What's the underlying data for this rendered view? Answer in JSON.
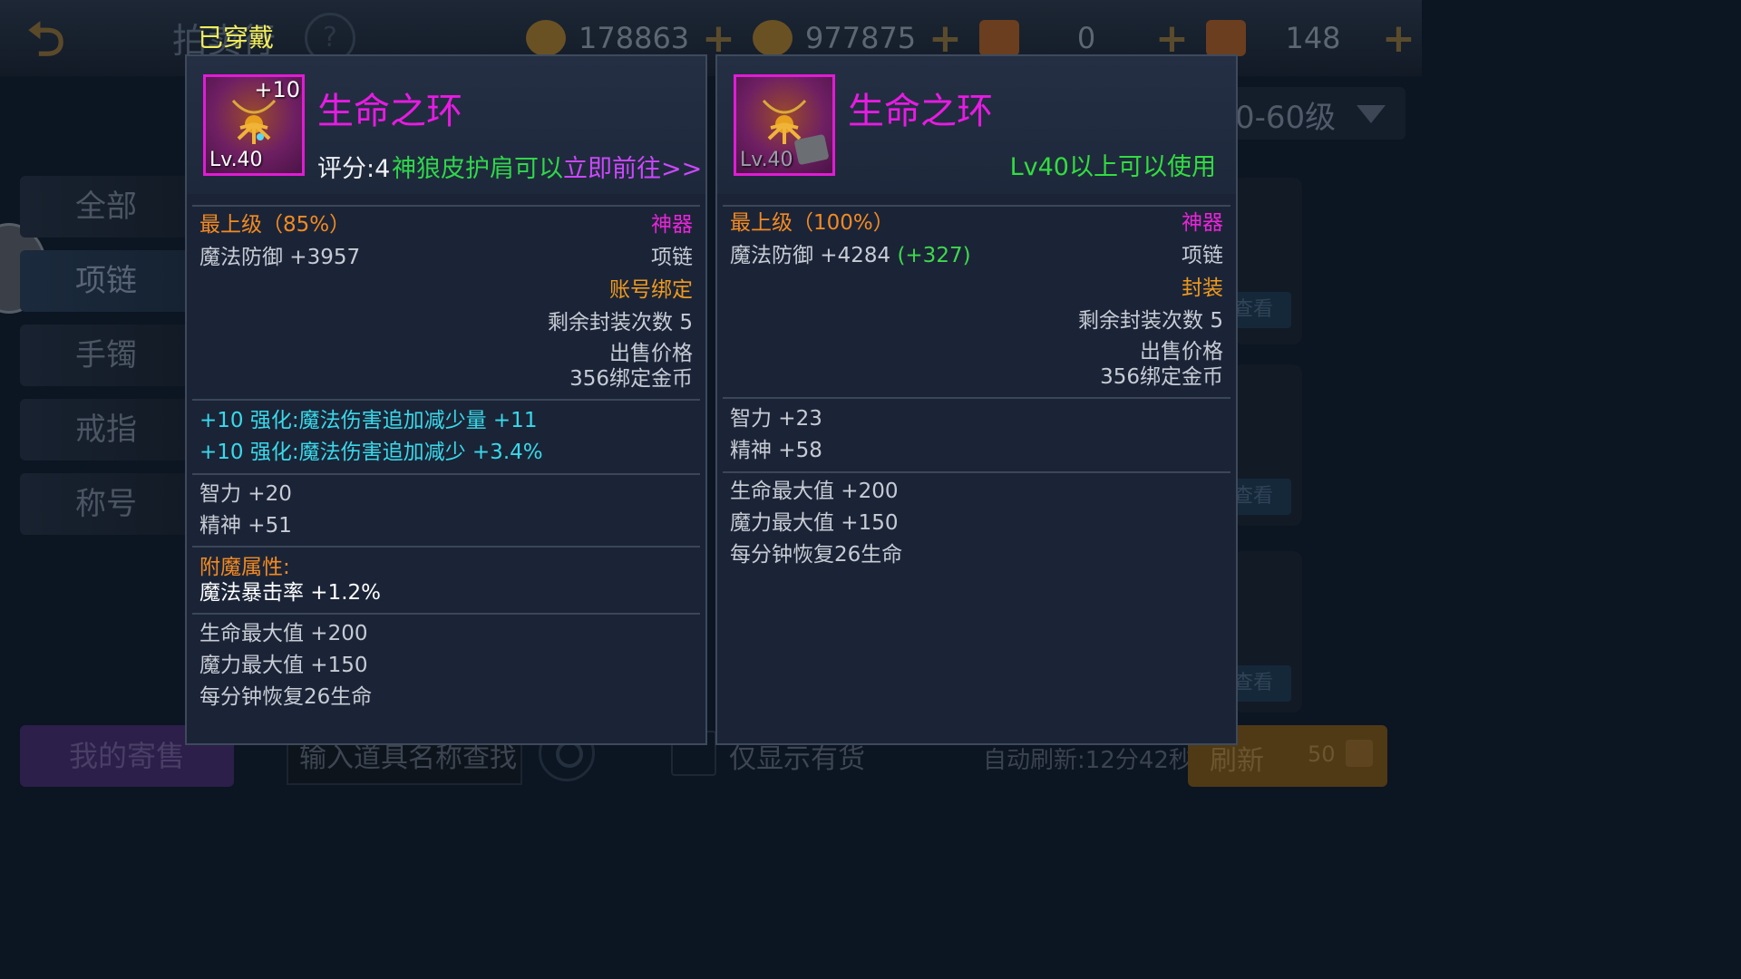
{
  "background": {
    "title": "拍卖行",
    "help_label": "?",
    "currencies": [
      {
        "icon": "coin-icon",
        "value": "178863",
        "plus": "+"
      },
      {
        "icon": "gold-coin-icon",
        "value": "977875",
        "plus": "+"
      },
      {
        "icon": "scroll-icon",
        "value": "0",
        "plus": "+"
      },
      {
        "icon": "scroll-icon",
        "value": "148",
        "plus": "+"
      }
    ],
    "level_filter": "0-60级",
    "categories": [
      "全部",
      "项链",
      "手镯",
      "戒指",
      "称号"
    ],
    "active_category": "项链",
    "detail_label": "查看详情",
    "my_sales": "我的寄售",
    "search_placeholder": "输入道具名称查找",
    "stock_only": "仅显示有货",
    "auto_refresh": "自动刷新:12分42秒",
    "refresh_label": "刷新",
    "refresh_cost": "50"
  },
  "equipped_tag": "已穿戴",
  "left_item": {
    "name": "生命之环",
    "enhance": "+10",
    "level": "Lv.40",
    "score": "评分:4",
    "promo_text": "神狼皮护肩",
    "promo_tail": "可以",
    "promo_link": "立即前往>>",
    "grade": "最上级（85%）",
    "rarity": "神器",
    "main_stat": "魔法防御 +3957",
    "slot": "项链",
    "binding": "账号绑定",
    "seal_count": "剩余封装次数 5",
    "sell_label": "出售价格",
    "sell_price": "356绑定金币",
    "enhance_lines": [
      "+10 强化:魔法伤害追加减少量 +11",
      "+10 强化:魔法伤害追加减少 +3.4%"
    ],
    "base_stats": [
      "智力 +20",
      "精神 +51"
    ],
    "enchant_title": "附魔属性:",
    "enchant_value": "魔法暴击率 +1.2%",
    "extra_stats": [
      "生命最大值 +200",
      "魔力最大值 +150",
      "每分钟恢复26生命"
    ]
  },
  "right_item": {
    "name": "生命之环",
    "level": "Lv.40",
    "usable": "Lv40以上可以使用",
    "grade": "最上级（100%）",
    "rarity": "神器",
    "main_stat": "魔法防御 +4284",
    "main_stat_diff": "(+327)",
    "slot": "项链",
    "binding": "封装",
    "seal_count": "剩余封装次数 5",
    "sell_label": "出售价格",
    "sell_price": "356绑定金币",
    "base_stats": [
      "智力 +23",
      "精神 +58"
    ],
    "extra_stats": [
      "生命最大值 +200",
      "魔力最大值 +150",
      "每分钟恢复26生命"
    ]
  }
}
